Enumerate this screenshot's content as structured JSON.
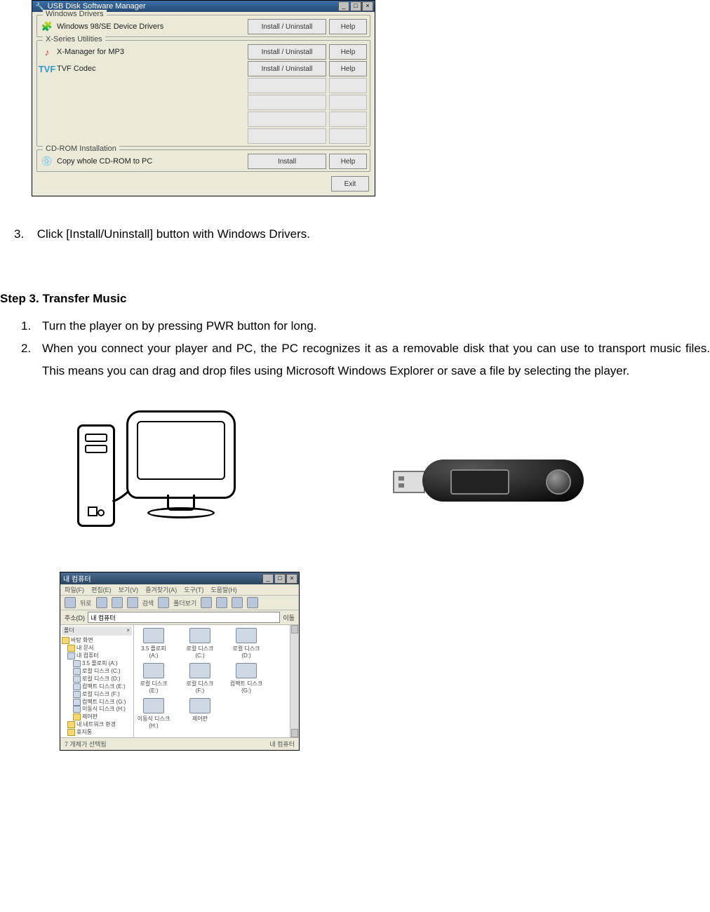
{
  "manager": {
    "title": "USB Disk Software Manager",
    "group_drivers": {
      "title": "Windows Drivers",
      "item_label": "Windows 98/SE Device Drivers",
      "install_btn": "Install / Uninstall",
      "help_btn": "Help"
    },
    "group_utils": {
      "title": "X-Series Utilities",
      "items": [
        {
          "label": "X-Manager for MP3",
          "install_btn": "Install / Uninstall",
          "help_btn": "Help"
        },
        {
          "label": "TVF Codec",
          "install_btn": "Install / Uninstall",
          "help_btn": "Help"
        }
      ]
    },
    "group_cdrom": {
      "title": "CD-ROM Installation",
      "item_label": "Copy whole CD-ROM to PC",
      "install_btn": "Install",
      "help_btn": "Help"
    },
    "exit_btn": "Exit"
  },
  "doc": {
    "step_after_image_num": "3.",
    "step_after_image_text": "Click [Install/Uninstall] button with Windows Drivers.",
    "step3_heading": "Step 3. Transfer Music",
    "step3_items": [
      {
        "num": "1.",
        "text": "Turn the player on by pressing PWR button for long."
      },
      {
        "num": "2.",
        "text": "When you connect your player and PC, the PC recognizes it as a removable disk that you can use to transport music files. This means you can drag and drop files using Microsoft Windows Explorer or save a file by selecting the player."
      }
    ]
  },
  "explorer": {
    "title": "내 컴퓨터",
    "menu": [
      "파일(F)",
      "편집(E)",
      "보기(V)",
      "즐겨찾기(A)",
      "도구(T)",
      "도움말(H)"
    ],
    "toolbar": [
      "뒤로",
      "",
      "",
      "검색",
      "폴더보기",
      "",
      "",
      "",
      ""
    ],
    "address_label": "주소(D)",
    "address_value": "내 컴퓨터",
    "go_btn": "이동",
    "tree_header": "폴더",
    "tree": [
      {
        "label": "바탕 화면",
        "indent": 0,
        "icon": "desktop"
      },
      {
        "label": "내 문서",
        "indent": 1,
        "icon": "folder"
      },
      {
        "label": "내 컴퓨터",
        "indent": 1,
        "icon": "computer"
      },
      {
        "label": "3.5 플로피 (A:)",
        "indent": 2,
        "icon": "drive"
      },
      {
        "label": "로컬 디스크 (C:)",
        "indent": 2,
        "icon": "drive"
      },
      {
        "label": "로컬 디스크 (D:)",
        "indent": 2,
        "icon": "drive"
      },
      {
        "label": "컴팩트 디스크 (E:)",
        "indent": 2,
        "icon": "drive"
      },
      {
        "label": "로컬 디스크 (F:)",
        "indent": 2,
        "icon": "drive"
      },
      {
        "label": "컴팩트 디스크 (G:)",
        "indent": 2,
        "icon": "drive"
      },
      {
        "label": "이동식 디스크 (H:)",
        "indent": 2,
        "icon": "drive"
      },
      {
        "label": "제어판",
        "indent": 2,
        "icon": "folder"
      },
      {
        "label": "내 네트워크 환경",
        "indent": 1,
        "icon": "network"
      },
      {
        "label": "휴지통",
        "indent": 1,
        "icon": "trash"
      }
    ],
    "drives": [
      "3.5 플로피 (A:)",
      "로컬 디스크 (C:)",
      "로컬 디스크 (D:)",
      "로컬 디스크 (E:)",
      "로컬 디스크 (F:)",
      "컴팩트 디스크 (G:)",
      "이동식 디스크 (H:)",
      "제어판"
    ],
    "status_left": "7 개체가 선택됨",
    "status_right": "내 컴퓨터"
  }
}
